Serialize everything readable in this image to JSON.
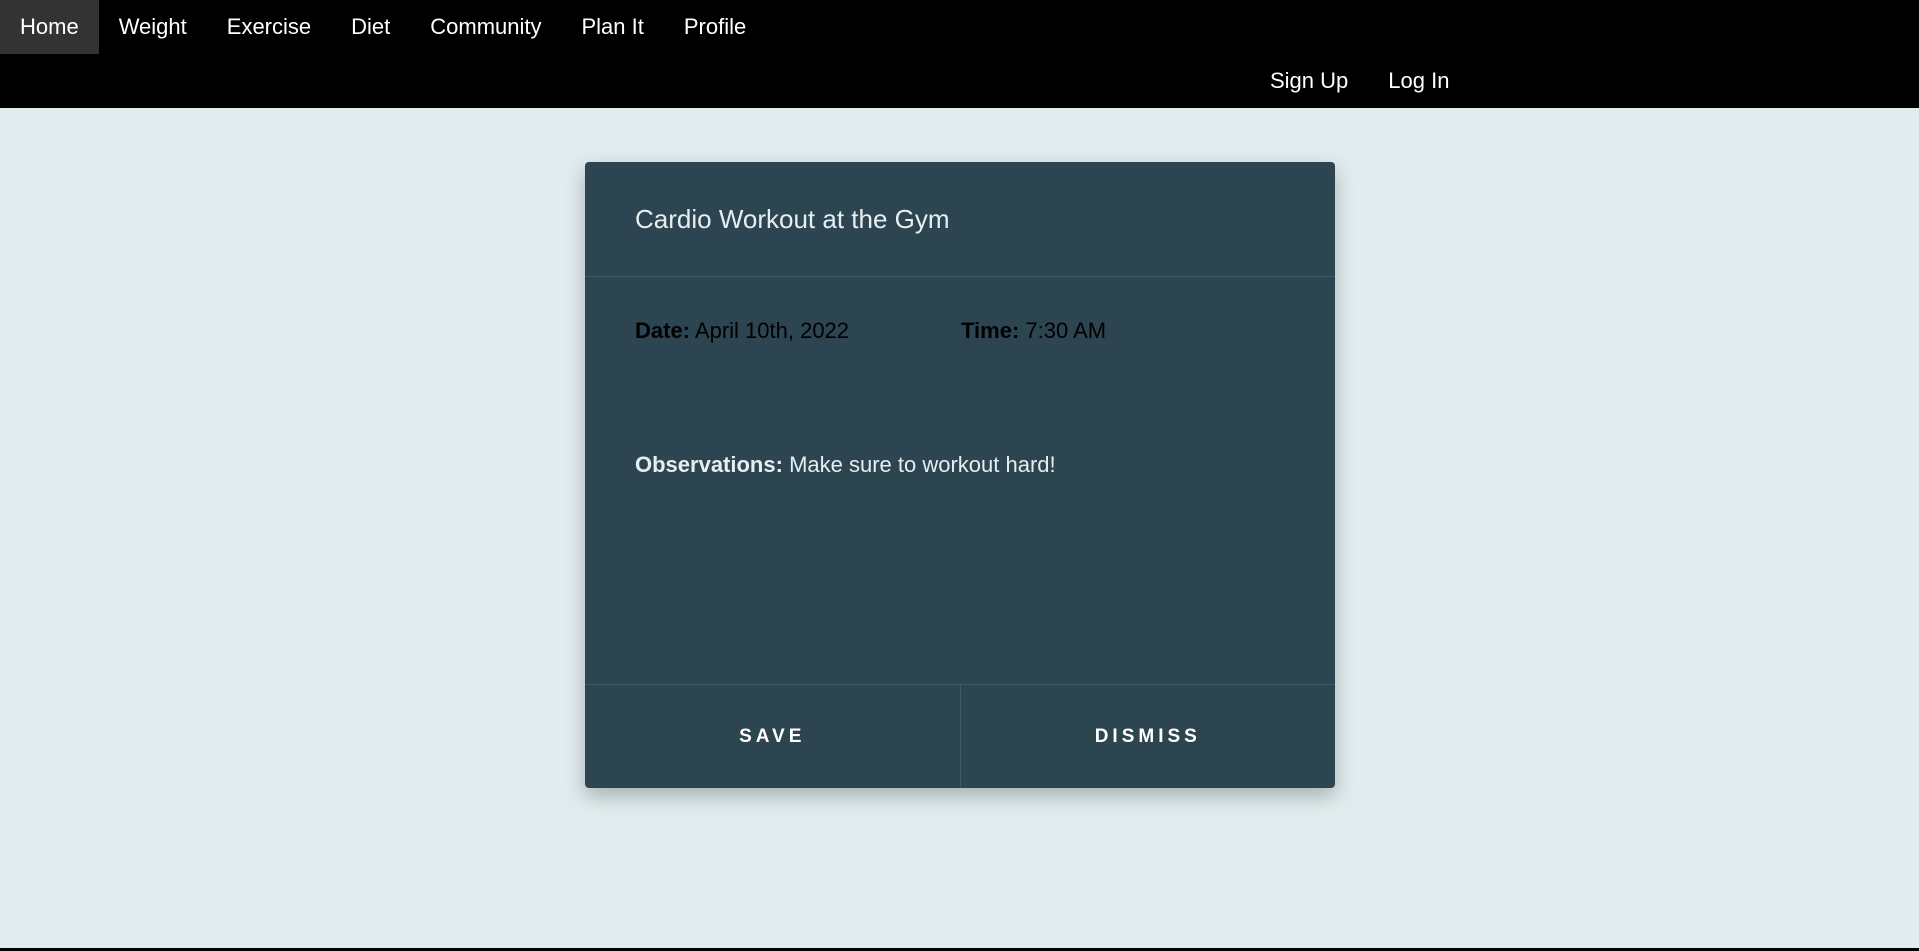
{
  "nav": {
    "items": [
      {
        "label": "Home",
        "active": true
      },
      {
        "label": "Weight",
        "active": false
      },
      {
        "label": "Exercise",
        "active": false
      },
      {
        "label": "Diet",
        "active": false
      },
      {
        "label": "Community",
        "active": false
      },
      {
        "label": "Plan It",
        "active": false
      },
      {
        "label": "Profile",
        "active": false
      }
    ],
    "auth": {
      "signup_label": "Sign Up",
      "login_label": "Log In"
    }
  },
  "card": {
    "title": "Cardio Workout at the Gym",
    "date_label": "Date:",
    "date_value": "April 10th, 2022",
    "time_label": "Time:",
    "time_value": "7:30 AM",
    "observations_label": "Observations:",
    "observations_value": "Make sure to workout hard!",
    "save_label": "SAVE",
    "dismiss_label": "DISMISS"
  },
  "colors": {
    "background": "#e0ecee",
    "topbar": "#000000",
    "card": "#2d4551",
    "active_nav": "#333333"
  }
}
